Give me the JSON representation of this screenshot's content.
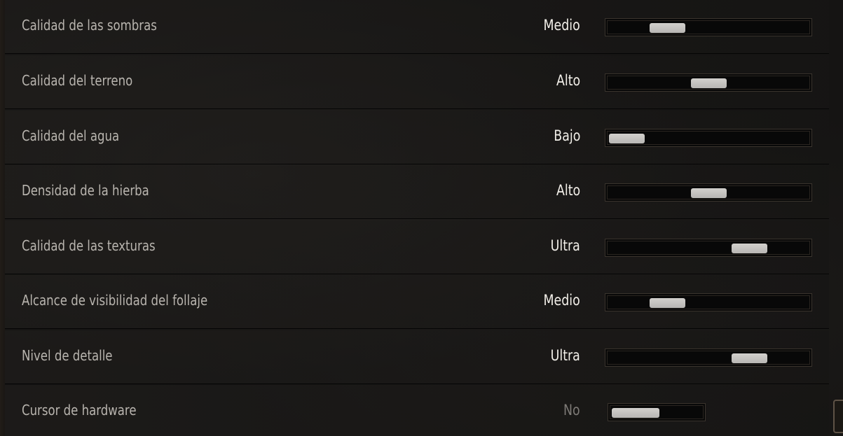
{
  "settings": [
    {
      "label": "Calidad de las sombras",
      "value": "Medio",
      "level": 0.25
    },
    {
      "label": "Calidad del terreno",
      "value": "Alto",
      "level": 0.5
    },
    {
      "label": "Calidad del agua",
      "value": "Bajo",
      "level": 0.0
    },
    {
      "label": "Densidad de la hierba",
      "value": "Alto",
      "level": 0.5
    },
    {
      "label": "Calidad de las texturas",
      "value": "Ultra",
      "level": 0.75
    },
    {
      "label": "Alcance de visibilidad del follaje",
      "value": "Medio",
      "level": 0.25
    },
    {
      "label": "Nivel de detalle",
      "value": "Ultra",
      "level": 0.75
    },
    {
      "label": "Cursor de hardware",
      "value": "No",
      "level": 0.0,
      "control": "toggle",
      "enabled": false
    }
  ],
  "colors": {
    "label": "#b9b5af",
    "value": "#f2efe9",
    "value_disabled": "#7d7a76",
    "thumb": "#c6c4c1",
    "track": "#080808",
    "track_border": "#3a342d"
  }
}
